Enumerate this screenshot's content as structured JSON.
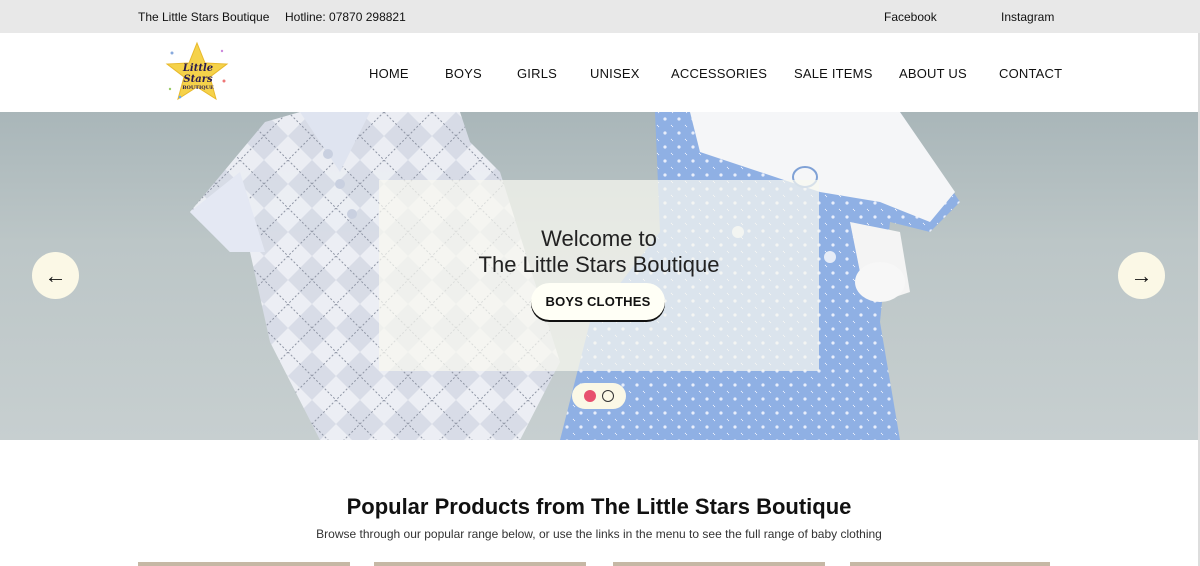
{
  "topbar": {
    "brand": "The Little Stars Boutique",
    "hotline": "Hotline: 07870 298821",
    "facebook": "Facebook",
    "instagram": "Instagram"
  },
  "logo": {
    "line1": "Little Stars",
    "line2": "BOUTIQUE"
  },
  "nav": [
    {
      "label": "HOME"
    },
    {
      "label": "BOYS"
    },
    {
      "label": "GIRLS"
    },
    {
      "label": "UNISEX"
    },
    {
      "label": "ACCESSORIES"
    },
    {
      "label": "SALE ITEMS"
    },
    {
      "label": "ABOUT US"
    },
    {
      "label": "CONTACT"
    }
  ],
  "hero": {
    "welcome_line1": "Welcome to",
    "welcome_line2": "The Little Stars Boutique",
    "cta_label": "BOYS CLOTHES",
    "prev_icon": "arrow-left-icon",
    "next_icon": "arrow-right-icon",
    "slides": 2,
    "active_slide": 1
  },
  "popular": {
    "title": "Popular Products from The Little Stars Boutique",
    "subtitle": "Browse through our popular range below, or use the links in the menu to see the full range of baby clothing"
  },
  "colors": {
    "topbar_bg": "#e8e8e8",
    "active_dot": "#e8506e",
    "button_bg": "#fbf8e6"
  }
}
